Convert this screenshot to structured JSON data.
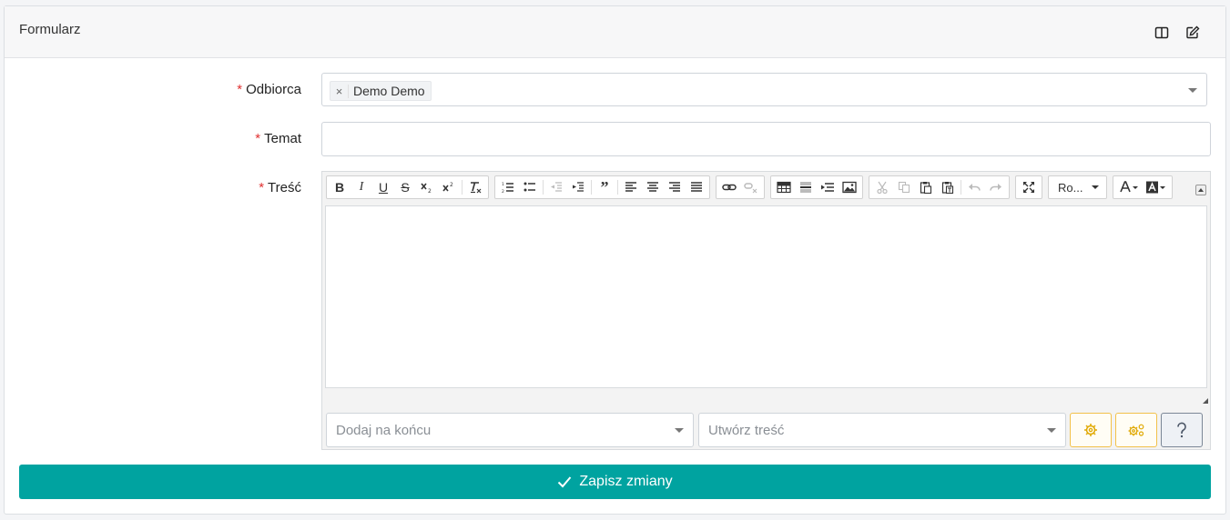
{
  "panel": {
    "title": "Formularz"
  },
  "fields": {
    "recipient": {
      "label": "Odbiorca",
      "required_mark": "*",
      "chips": [
        "Demo Demo"
      ],
      "remove_glyph": "×"
    },
    "subject": {
      "label": "Temat",
      "required_mark": "*",
      "value": ""
    },
    "body": {
      "label": "Treść",
      "required_mark": "*"
    }
  },
  "editor": {
    "font_combo": "Ro...",
    "append_select": {
      "placeholder": "Dodaj na końcu"
    },
    "create_select": {
      "placeholder": "Utwórz treść"
    }
  },
  "actions": {
    "save_label": "Zapisz zmiany"
  },
  "colors": {
    "accent": "#00a3a0",
    "required": "#e03131",
    "warning_border": "#f2c14a"
  },
  "icons": [
    "columns-icon",
    "edit-icon",
    "bold-icon",
    "italic-icon",
    "underline-icon",
    "strikethrough-icon",
    "subscript-icon",
    "superscript-icon",
    "remove-format-icon",
    "numbered-list-icon",
    "bullet-list-icon",
    "outdent-icon",
    "indent-icon",
    "blockquote-icon",
    "align-left-icon",
    "align-center-icon",
    "align-right-icon",
    "align-justify-icon",
    "link-icon",
    "unlink-icon",
    "table-icon",
    "horizontal-line-icon",
    "page-break-icon",
    "image-icon",
    "cut-icon",
    "copy-icon",
    "paste-icon",
    "paste-text-icon",
    "undo-icon",
    "redo-icon",
    "maximize-icon",
    "text-color-icon",
    "background-color-icon",
    "gear-icon",
    "gears-icon",
    "question-icon",
    "check-icon"
  ]
}
